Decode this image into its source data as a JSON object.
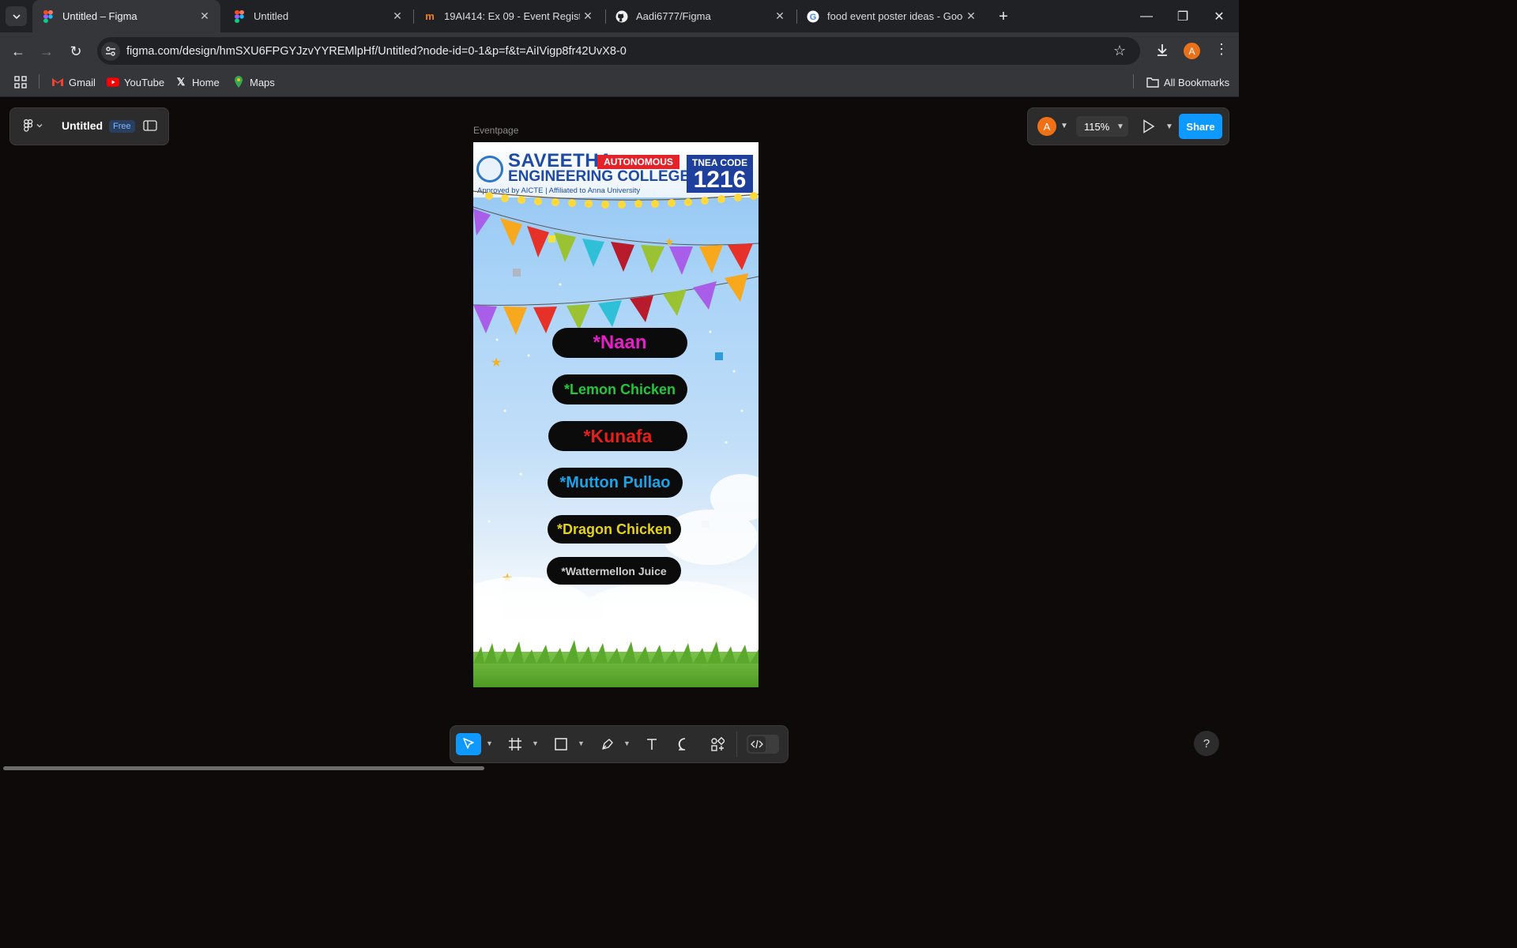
{
  "browser": {
    "tabs": [
      {
        "title": "Untitled – Figma",
        "favicon": "figma-icon",
        "active": true
      },
      {
        "title": "Untitled",
        "favicon": "figma-icon",
        "active": false
      },
      {
        "title": "19AI414: Ex 09 - Event Registrat",
        "favicon": "moodle-icon",
        "active": false
      },
      {
        "title": "Aadi6777/Figma",
        "favicon": "github-icon",
        "active": false
      },
      {
        "title": "food event poster ideas - Goog",
        "favicon": "google-icon",
        "active": false
      }
    ],
    "url": "figma.com/design/hmSXU6FPGYJzvYYREMlpHf/Untitled?node-id=0-1&p=f&t=AiIVigp8fr42UvX8-0",
    "profile_initial": "A",
    "bookmarks": [
      "Gmail",
      "YouTube",
      "Home",
      "Maps"
    ],
    "all_bookmarks": "All Bookmarks"
  },
  "figma": {
    "file_name": "Untitled",
    "plan_badge": "Free",
    "user_initial": "A",
    "zoom": "115%",
    "share_label": "Share",
    "frame_label": "Eventpage",
    "help_label": "?"
  },
  "poster": {
    "college_line1": "SAVEETHA",
    "college_line2": "ENGINEERING COLLEGE",
    "autonomous": "AUTONOMOUS",
    "approved": "Approved by AICTE | Affiliated to Anna University",
    "tnea_label": "TNEA CODE",
    "tnea_code": "1216",
    "menu_items": [
      {
        "label": "*Naan",
        "color": "#e61ec8"
      },
      {
        "label": "*Lemon Chicken",
        "color": "#1fc93a"
      },
      {
        "label": "*Kunafa",
        "color": "#e3201b"
      },
      {
        "label": "*Mutton Pullao",
        "color": "#1aa3e8"
      },
      {
        "label": "*Dragon Chicken",
        "color": "#e5d21a"
      },
      {
        "label": "*Wattermellon Juice",
        "color": "#cfcfcf"
      }
    ]
  },
  "colors": {
    "accent": "#0d99ff",
    "background": "#0e0a0a"
  }
}
